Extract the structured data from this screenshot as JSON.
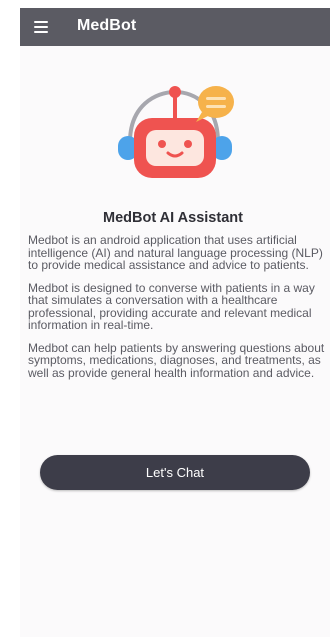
{
  "app": {
    "title": "MedBot",
    "menu_icon": "hamburger-menu-icon",
    "logo_icon": "robot-chat-icon"
  },
  "colors": {
    "appbar": "#5b5b63",
    "button": "#3d3d49",
    "robot_red": "#ef5350",
    "bubble_orange": "#f6b24b",
    "headset_blue": "#4da3ea"
  },
  "main": {
    "heading": "MedBot AI Assistant",
    "paragraphs": [
      "Medbot is an android application that uses artificial intelligence (AI) and natural language processing (NLP) to provide medical assistance and advice to patients.",
      "Medbot is designed to converse with patients in a way that simulates a conversation with a healthcare professional, providing accurate and relevant medical information in real-time.",
      "Medbot can help patients by answering questions about symptoms, medications, diagnoses, and treatments, as well as provide general health information and advice."
    ],
    "chat_button_label": "Let's Chat"
  }
}
